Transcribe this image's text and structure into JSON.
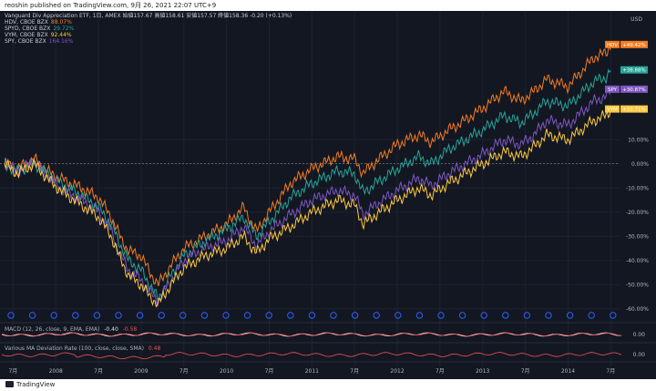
{
  "publisher_line": "reoshin published on TradingView.com, 9月 26, 2021 22:07 UTC+9",
  "footer_brand": "TradingView",
  "colors": {
    "background": "#131722",
    "hdv": "#f57c1f",
    "spyd": "#26a69a",
    "vym": "#ffc93d",
    "spy": "#7e57c2",
    "macd": "#f0f0f0",
    "signal": "#ef5350",
    "deviation": "#ef5350",
    "zero_line": "#9aa0a6",
    "event_marker": "#2962ff"
  },
  "legend": [
    {
      "name": "Vanguard Div Appreciation ETF, 1日, AMEX  始値157.67 高値158.61 安値157.57 終値158.36 -0.20 (+0.13%)",
      "value": "",
      "color": "#c9ccd4"
    },
    {
      "name": "HDV, CBOE BZX",
      "value": "88.07%",
      "color": "#f57c1f"
    },
    {
      "name": "SPYD, CBOE BZX",
      "value": "29.72%",
      "color": "#26a69a"
    },
    {
      "name": "VYM, CBOE BZX",
      "value": "92.44%",
      "color": "#ffc93d"
    },
    {
      "name": "SPY, CBOE BZX",
      "value": "164.16%",
      "color": "#7e57c2"
    }
  ],
  "chart_data": {
    "type": "line",
    "y_unit": "%",
    "ylim": [
      -65,
      55
    ],
    "y_ticks": [
      "10.00%",
      "0.00%",
      "-10.00%",
      "-20.00%",
      "-30.00%",
      "-40.00%",
      "-50.00%",
      "-60.00%"
    ],
    "x_tick_labels": [
      "7月",
      "2008",
      "7月",
      "2009",
      "7月",
      "2010",
      "7月",
      "2011",
      "7月",
      "2012",
      "7月",
      "2013",
      "7月",
      "2014",
      "7月"
    ],
    "x_ticks": [
      2007.5,
      2008.0,
      2008.5,
      2009.0,
      2009.5,
      2010.0,
      2010.5,
      2011.0,
      2011.5,
      2012.0,
      2012.5,
      2013.0,
      2013.5,
      2014.0,
      2014.5
    ],
    "xlim": [
      2007.4,
      2014.55
    ],
    "corner_label": "USD",
    "series": [
      {
        "name": "HDV",
        "color": "#f57c1f",
        "last_label": "HDV",
        "last_value": "+49.42%",
        "x": [
          2007.4,
          2007.55,
          2007.75,
          2007.9,
          2008.05,
          2008.3,
          2008.5,
          2008.65,
          2008.75,
          2008.85,
          2009.0,
          2009.1,
          2009.2,
          2009.35,
          2009.5,
          2009.75,
          2010.0,
          2010.2,
          2010.35,
          2010.5,
          2010.75,
          2011.0,
          2011.3,
          2011.5,
          2011.6,
          2011.75,
          2012.0,
          2012.25,
          2012.4,
          2012.6,
          2012.75,
          2013.0,
          2013.25,
          2013.45,
          2013.6,
          2013.75,
          2014.0,
          2014.15,
          2014.3,
          2014.45,
          2014.5
        ],
        "values": [
          0,
          -2,
          2,
          -3,
          -6,
          -10,
          -14,
          -22,
          -30,
          -36,
          -38,
          -45,
          -50,
          -42,
          -35,
          -30,
          -25,
          -18,
          -28,
          -20,
          -8,
          -2,
          3,
          2,
          -4,
          1,
          8,
          12,
          9,
          14,
          17,
          23,
          30,
          26,
          30,
          35,
          32,
          38,
          44,
          46,
          49.4
        ]
      },
      {
        "name": "SPYD",
        "color": "#26a69a",
        "last_label": "",
        "last_value": "+38.88%",
        "x": [
          2007.4,
          2007.55,
          2007.75,
          2007.9,
          2008.05,
          2008.3,
          2008.5,
          2008.65,
          2008.75,
          2008.85,
          2009.0,
          2009.1,
          2009.2,
          2009.35,
          2009.5,
          2009.75,
          2010.0,
          2010.2,
          2010.35,
          2010.5,
          2010.75,
          2011.0,
          2011.3,
          2011.5,
          2011.6,
          2011.75,
          2012.0,
          2012.25,
          2012.4,
          2012.6,
          2012.75,
          2013.0,
          2013.25,
          2013.45,
          2013.6,
          2013.75,
          2014.0,
          2014.15,
          2014.3,
          2014.45,
          2014.5
        ],
        "values": [
          0,
          -3,
          0,
          -4,
          -8,
          -13,
          -18,
          -25,
          -33,
          -40,
          -44,
          -50,
          -56,
          -46,
          -38,
          -32,
          -27,
          -22,
          -30,
          -24,
          -14,
          -8,
          -3,
          -4,
          -12,
          -8,
          -2,
          3,
          0,
          6,
          9,
          14,
          20,
          17,
          21,
          26,
          24,
          29,
          34,
          36,
          38.9
        ]
      },
      {
        "name": "SPY",
        "color": "#7e57c2",
        "last_label": "SPY",
        "last_value": "+30.87%",
        "x": [
          2007.4,
          2007.55,
          2007.75,
          2007.9,
          2008.05,
          2008.3,
          2008.5,
          2008.65,
          2008.75,
          2008.85,
          2009.0,
          2009.1,
          2009.2,
          2009.35,
          2009.5,
          2009.75,
          2010.0,
          2010.2,
          2010.35,
          2010.5,
          2010.75,
          2011.0,
          2011.3,
          2011.5,
          2011.6,
          2011.75,
          2012.0,
          2012.25,
          2012.4,
          2012.6,
          2012.75,
          2013.0,
          2013.25,
          2013.45,
          2013.6,
          2013.75,
          2014.0,
          2014.15,
          2014.3,
          2014.45,
          2014.5
        ],
        "values": [
          0,
          -3,
          1,
          -5,
          -10,
          -15,
          -20,
          -28,
          -37,
          -44,
          -48,
          -53,
          -57,
          -48,
          -40,
          -35,
          -32,
          -26,
          -34,
          -28,
          -21,
          -15,
          -11,
          -13,
          -21,
          -17,
          -11,
          -6,
          -9,
          -4,
          -1,
          4,
          10,
          8,
          12,
          18,
          16,
          21,
          26,
          28,
          30.9
        ]
      },
      {
        "name": "VYM",
        "color": "#ffc93d",
        "last_label": "VYM",
        "last_value": "+22.71%",
        "x": [
          2007.4,
          2007.55,
          2007.75,
          2007.9,
          2008.05,
          2008.3,
          2008.5,
          2008.65,
          2008.75,
          2008.85,
          2009.0,
          2009.1,
          2009.2,
          2009.35,
          2009.5,
          2009.75,
          2010.0,
          2010.2,
          2010.35,
          2010.5,
          2010.75,
          2011.0,
          2011.3,
          2011.5,
          2011.6,
          2011.75,
          2012.0,
          2012.25,
          2012.4,
          2012.6,
          2012.75,
          2013.0,
          2013.25,
          2013.45,
          2013.6,
          2013.75,
          2014.0,
          2014.15,
          2014.3,
          2014.45,
          2014.5
        ],
        "values": [
          0,
          -4,
          0,
          -6,
          -11,
          -17,
          -22,
          -30,
          -39,
          -46,
          -50,
          -55,
          -58,
          -50,
          -43,
          -38,
          -35,
          -30,
          -37,
          -31,
          -26,
          -20,
          -15,
          -17,
          -25,
          -21,
          -15,
          -10,
          -13,
          -8,
          -5,
          0,
          5,
          3,
          7,
          12,
          10,
          14,
          18,
          20,
          22.7
        ]
      }
    ]
  },
  "panels": [
    {
      "title": "MACD (12, 26, close, 9, EMA, EMA)",
      "val1": "-0.40",
      "val2": "-0.58",
      "axis_label": "0.00"
    },
    {
      "title": "Various MA Deviation Rate (100, close, close, SMA)",
      "val1": "0.48",
      "val2": "",
      "axis_label": "0.00"
    }
  ]
}
